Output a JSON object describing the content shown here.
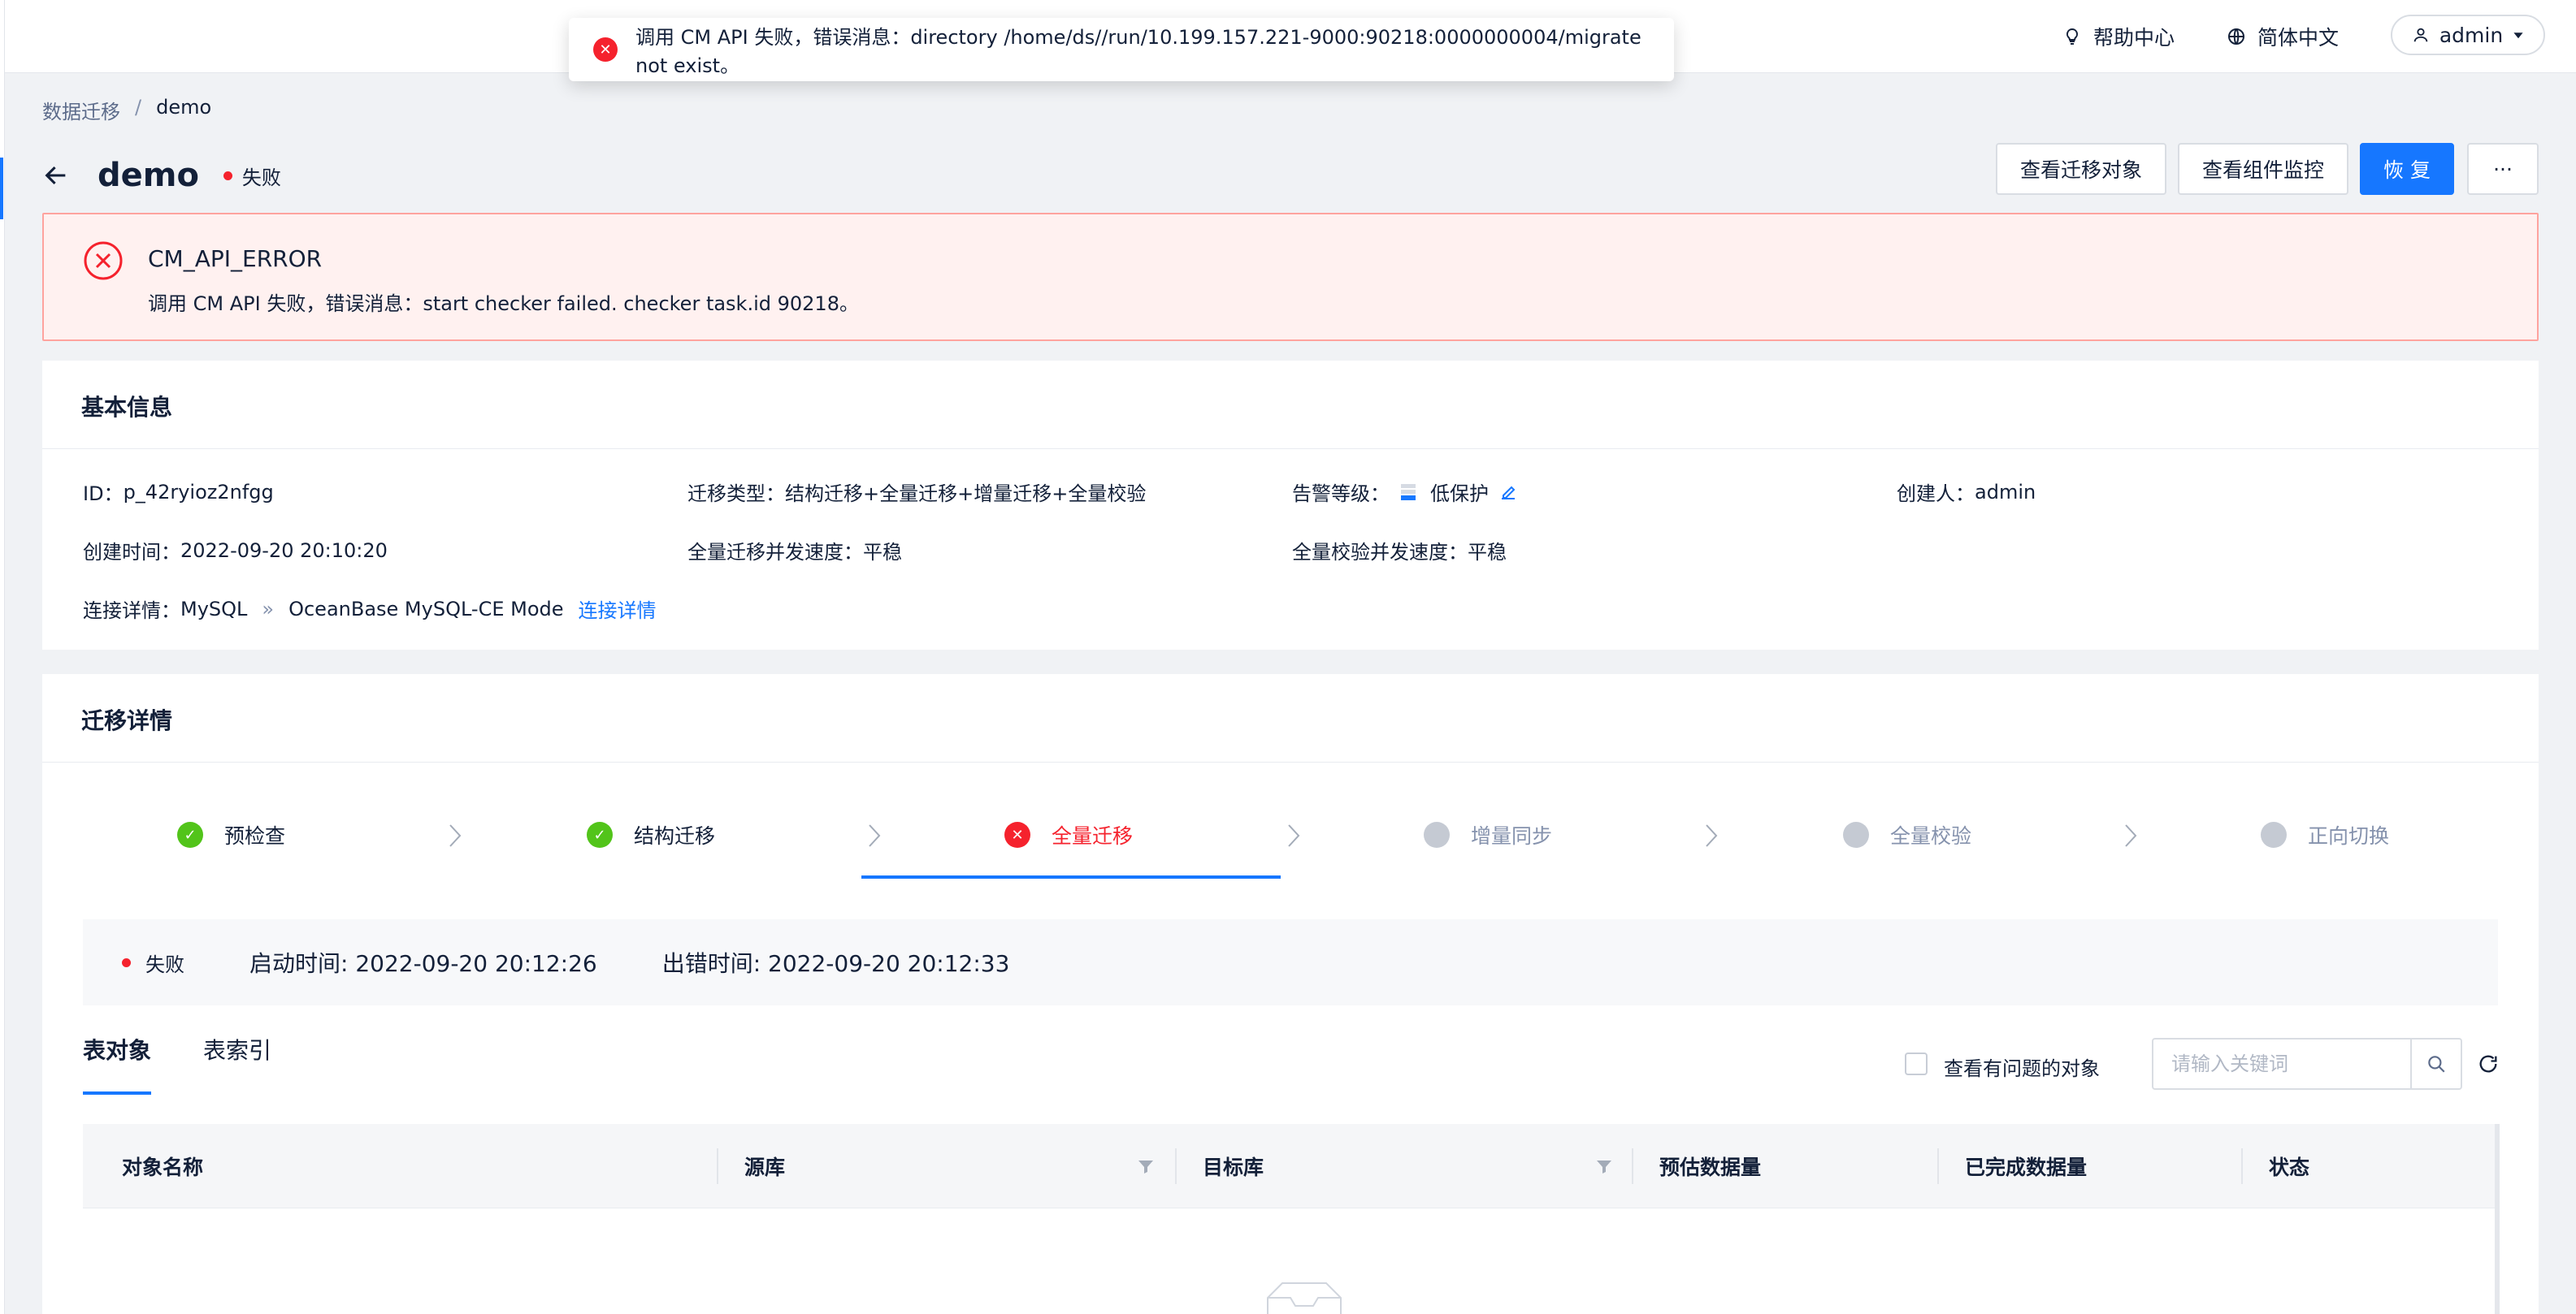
{
  "toast": {
    "message": "调用 CM API 失败，错误消息：directory /home/ds//run/10.199.157.221-9000:90218:0000000004/migrate not exist。"
  },
  "header": {
    "help": "帮助中心",
    "language": "简体中文",
    "user": "admin"
  },
  "breadcrumb": {
    "parent": "数据迁移",
    "separator": "/",
    "current": "demo"
  },
  "page": {
    "title": "demo",
    "status": "失败"
  },
  "actions": {
    "view_objects": "查看迁移对象",
    "view_monitor": "查看组件监控",
    "resume": "恢 复",
    "more": "···"
  },
  "alert": {
    "title": "CM_API_ERROR",
    "message": "调用 CM API 失败，错误消息：start checker failed. checker task.id 90218。"
  },
  "basic_info": {
    "title": "基本信息",
    "id_label": "ID：",
    "id_value": "p_42ryioz2nfgg",
    "type_label": "迁移类型：",
    "type_value": "结构迁移+全量迁移+增量迁移+全量校验",
    "alarm_label": "告警等级：",
    "alarm_value": "低保护",
    "creator_label": "创建人：",
    "creator_value": "admin",
    "created_label": "创建时间：",
    "created_value": "2022-09-20 20:10:20",
    "full_speed_label": "全量迁移并发速度：",
    "full_speed_value": "平稳",
    "verify_speed_label": "全量校验并发速度：",
    "verify_speed_value": "平稳",
    "conn_label": "连接详情：",
    "conn_source": "MySQL",
    "conn_arrow": "»",
    "conn_target": "OceanBase MySQL-CE Mode",
    "conn_link": "连接详情"
  },
  "migration_detail": {
    "title": "迁移详情",
    "steps": [
      {
        "label": "预检查",
        "state": "done"
      },
      {
        "label": "结构迁移",
        "state": "done"
      },
      {
        "label": "全量迁移",
        "state": "error"
      },
      {
        "label": "增量同步",
        "state": "wait"
      },
      {
        "label": "全量校验",
        "state": "wait"
      },
      {
        "label": "正向切换",
        "state": "wait"
      }
    ],
    "status": "失败",
    "start_time": "启动时间: 2022-09-20 20:12:26",
    "error_time": "出错时间: 2022-09-20 20:12:33"
  },
  "tabs": [
    "表对象",
    "表索引"
  ],
  "filter": {
    "problem_only": "查看有问题的对象",
    "search_placeholder": "请输入关键词"
  },
  "table": {
    "columns": [
      "对象名称",
      "源库",
      "目标库",
      "预估数据量",
      "已完成数据量",
      "状态"
    ]
  },
  "colors": {
    "accent": "#1677ff",
    "error": "#f5222d",
    "success": "#52c41a",
    "pending": "#c5cad3"
  }
}
